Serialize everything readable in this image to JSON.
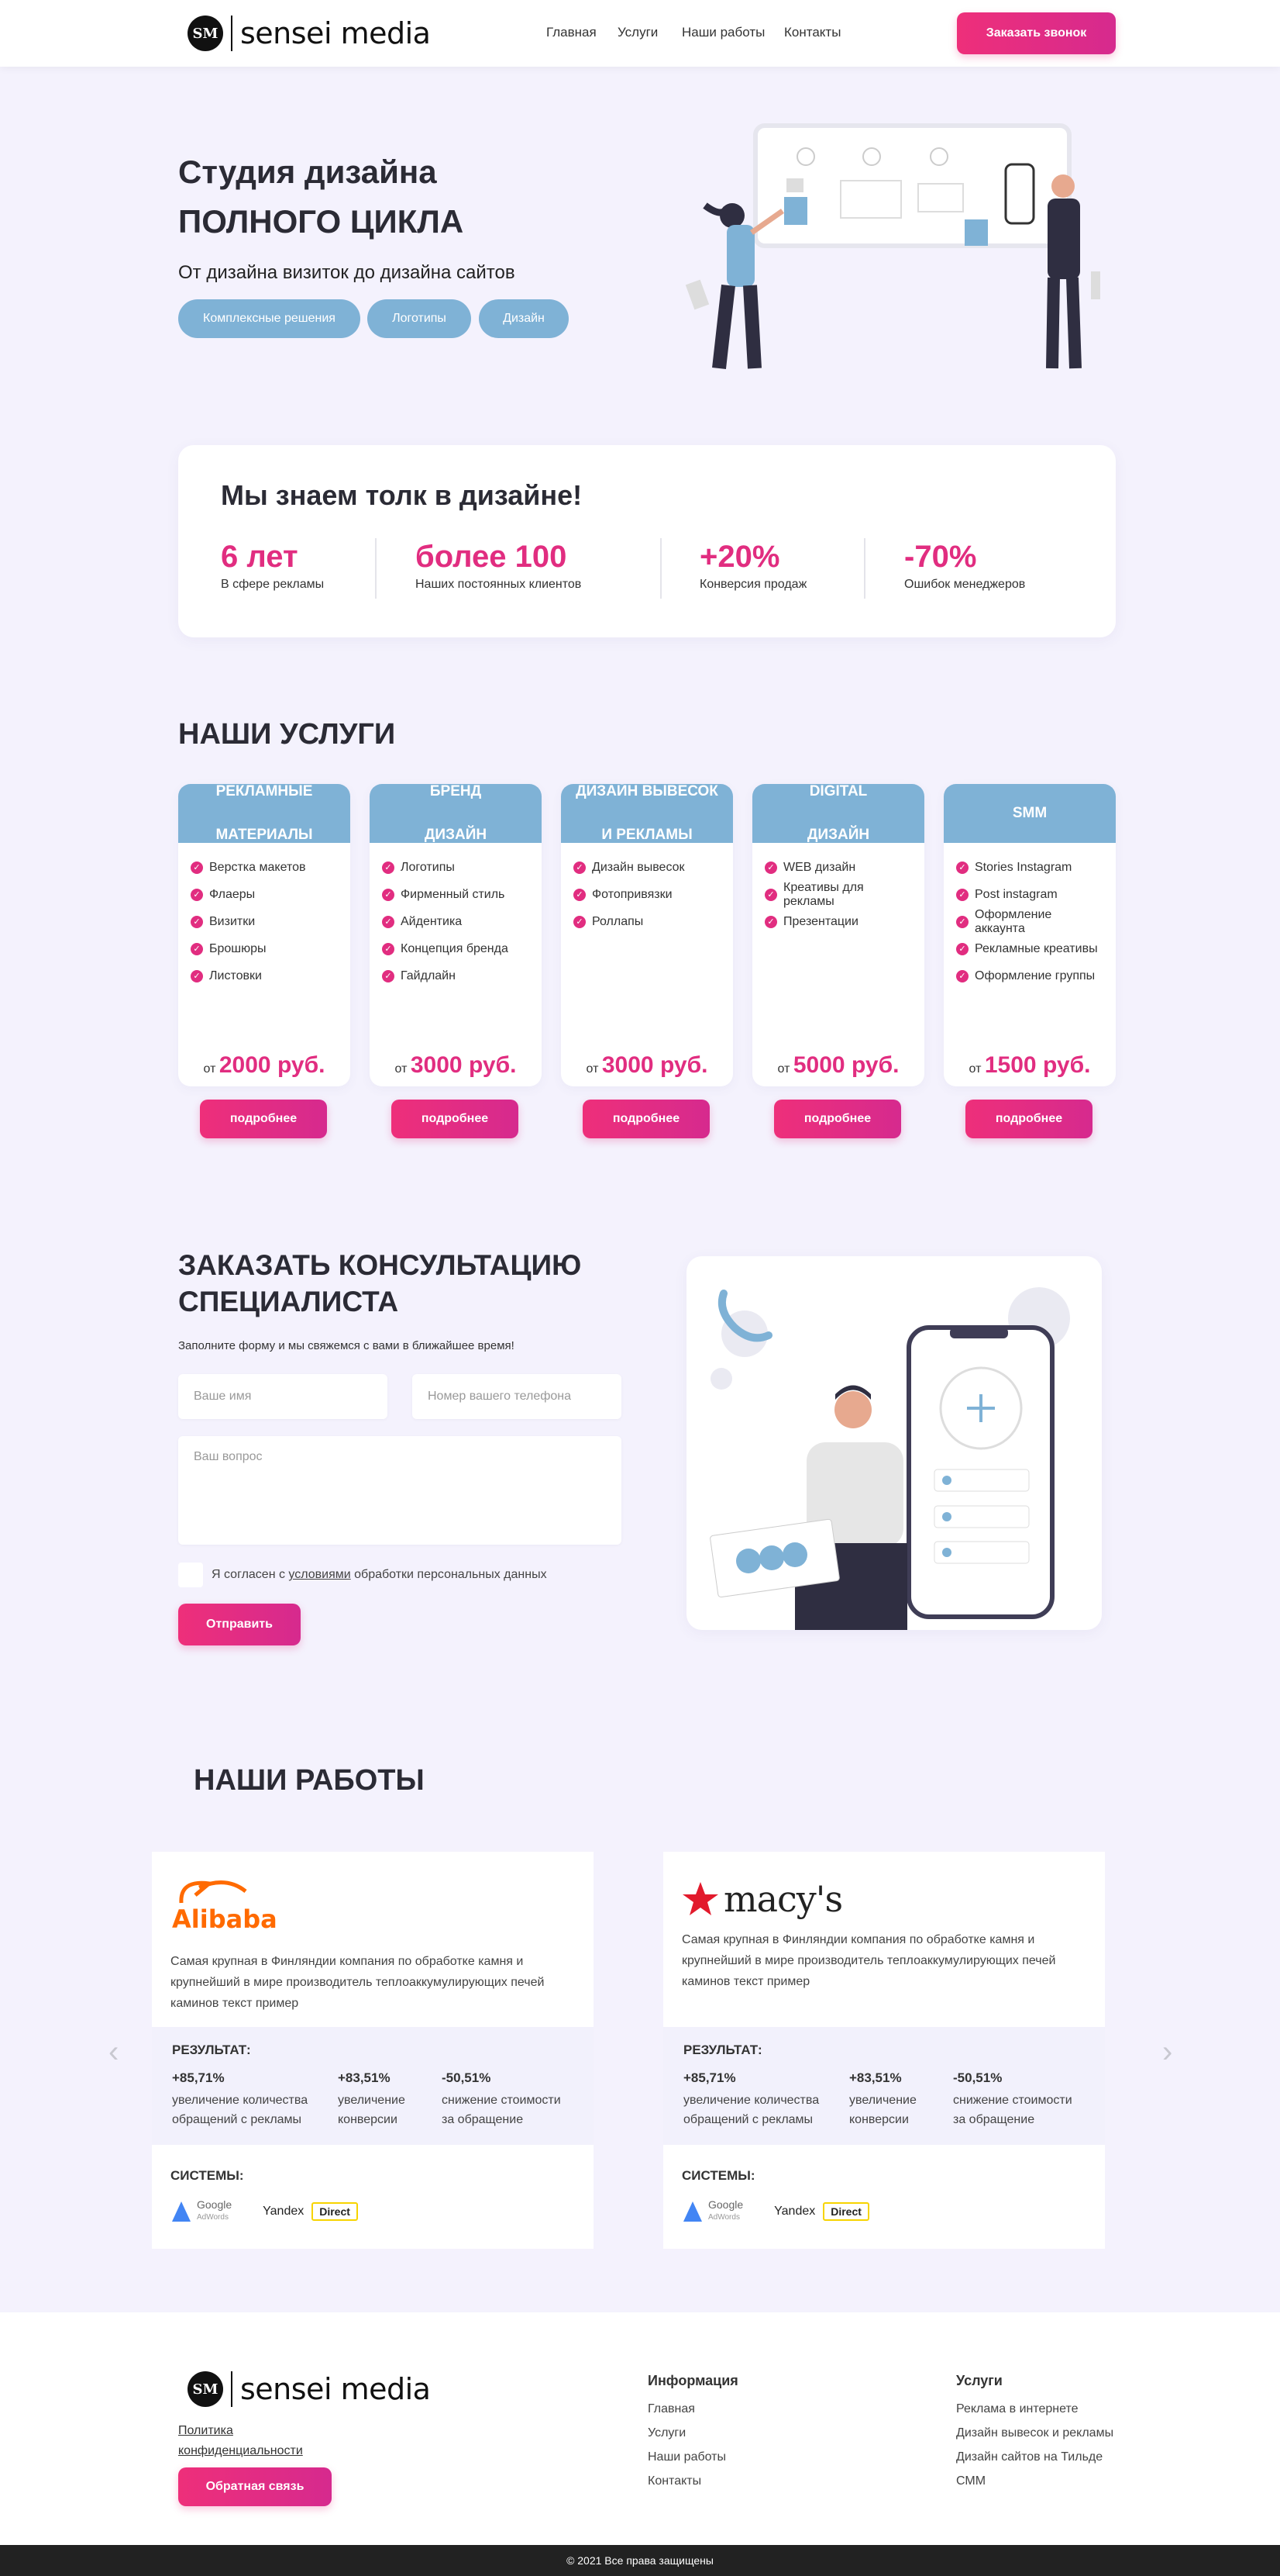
{
  "header": {
    "logo_badge": "SM",
    "logo_text": "sensei media",
    "nav": [
      "Главная",
      "Услуги",
      "Наши работы",
      "Контакты"
    ],
    "cta": "Заказать звонок"
  },
  "hero": {
    "title_line1": "Студия дизайна",
    "title_line2": "ПОЛНОГО ЦИКЛА",
    "subtitle": "От дизайна визиток до дизайна сайтов",
    "pills": [
      "Комплексные решения",
      "Логотипы",
      "Дизайн"
    ]
  },
  "stats": {
    "title": "Мы знаем толк в дизайне!",
    "items": [
      {
        "value": "6 лет",
        "label": "В сфере рекламы"
      },
      {
        "value": "более 100",
        "label": "Наших постоянных клиентов"
      },
      {
        "value": "+20%",
        "label": "Конверсия продаж"
      },
      {
        "value": "-70%",
        "label": "Ошибок менеджеров"
      }
    ]
  },
  "services": {
    "title": "НАШИ УСЛУГИ",
    "more_label": "подробнее",
    "price_prefix": "от",
    "cards": [
      {
        "line1": "РЕКЛАМНЫЕ",
        "line2": "МАТЕРИАЛЫ",
        "items": [
          "Верстка макетов",
          "Флаеры",
          "Визитки",
          "Брошюры",
          "Листовки"
        ],
        "price": "2000 руб."
      },
      {
        "line1": "БРЕНД",
        "line2": "ДИЗАЙН",
        "items": [
          "Логотипы",
          "Фирменный стиль",
          "Айдентика",
          "Концепция бренда",
          "Гайдлайн"
        ],
        "price": "3000 руб."
      },
      {
        "line1": "ДИЗАЙН ВЫВЕСОК",
        "line2": "И РЕКЛАМЫ",
        "items": [
          "Дизайн вывесок",
          "Фотопривязки",
          "Роллапы"
        ],
        "price": "3000 руб."
      },
      {
        "line1": "DIGITAL",
        "line2": "ДИЗАЙН",
        "items": [
          "WEB дизайн",
          "Креативы для рекламы",
          "Презентации"
        ],
        "price": "5000 руб."
      },
      {
        "line1": "SMM",
        "line2": "",
        "items": [
          "Stories Instagram",
          "Post instagram",
          "Оформление аккаунта",
          "Рекламные креативы",
          "Оформление группы"
        ],
        "price": "1500 руб."
      }
    ]
  },
  "consult": {
    "title_line1": "ЗАКАЗАТЬ КОНСУЛЬТАЦИЮ",
    "title_line2": "СПЕЦИАЛИСТА",
    "subtitle": "Заполните форму и мы свяжемся с вами в ближайшее время!",
    "name_placeholder": "Ваше имя",
    "phone_placeholder": "Номер вашего телефона",
    "question_placeholder": "Ваш вопрос",
    "agree_pre": "Я согласен с ",
    "agree_link": "условиями",
    "agree_post": " обработки персональных данных",
    "submit": "Отправить"
  },
  "works": {
    "title": "НАШИ РАБОТЫ",
    "result_title": "РЕЗУЛЬТАТ:",
    "systems_title": "СИСТЕМЫ:",
    "google_text": "Google",
    "adwords_text": "AdWords",
    "yandex_text": "Yandex",
    "direct_text": "Direct",
    "items": [
      {
        "brand": "Alibaba",
        "description": "Самая крупная в Финляндии компания по обработке камня и крупнейший в мире производитель теплоаккумулирующих печей каминов текст пример",
        "results": [
          {
            "value": "+85,71%",
            "label1": "увеличение количества",
            "label2": "обращений с рекламы"
          },
          {
            "value": "+83,51%",
            "label1": "увеличение",
            "label2": "конверсии"
          },
          {
            "value": "-50,51%",
            "label1": "снижение стоимости",
            "label2": "за обращение"
          }
        ]
      },
      {
        "brand": "macy's",
        "description": "Самая крупная в Финляндии компания по обработке камня и крупнейший в мире производитель теплоаккумулирующих печей каминов текст пример",
        "results": [
          {
            "value": "+85,71%",
            "label1": "увеличение количества",
            "label2": "обращений с рекламы"
          },
          {
            "value": "+83,51%",
            "label1": "увеличение",
            "label2": "конверсии"
          },
          {
            "value": "-50,51%",
            "label1": "снижение стоимости",
            "label2": "за обращение"
          }
        ]
      }
    ]
  },
  "footer": {
    "logo_badge": "SM",
    "logo_text": "sensei media",
    "privacy_line1": "Политика",
    "privacy_line2": "конфиденциальности",
    "feedback": "Обратная связь",
    "info_title": "Информация",
    "info_links": [
      "Главная",
      "Услуги",
      "Наши работы",
      "Контакты"
    ],
    "services_title": "Услуги",
    "services_links": [
      "Реклама в интернете",
      "Дизайн вывесок и рекламы",
      "Дизайн сайтов на Тильде",
      "СММ"
    ],
    "copyright": "© 2021 Все права защищены"
  },
  "colors": {
    "accent": "#e12d80",
    "blue": "#7fb2d6",
    "background": "#f4f2fd"
  }
}
